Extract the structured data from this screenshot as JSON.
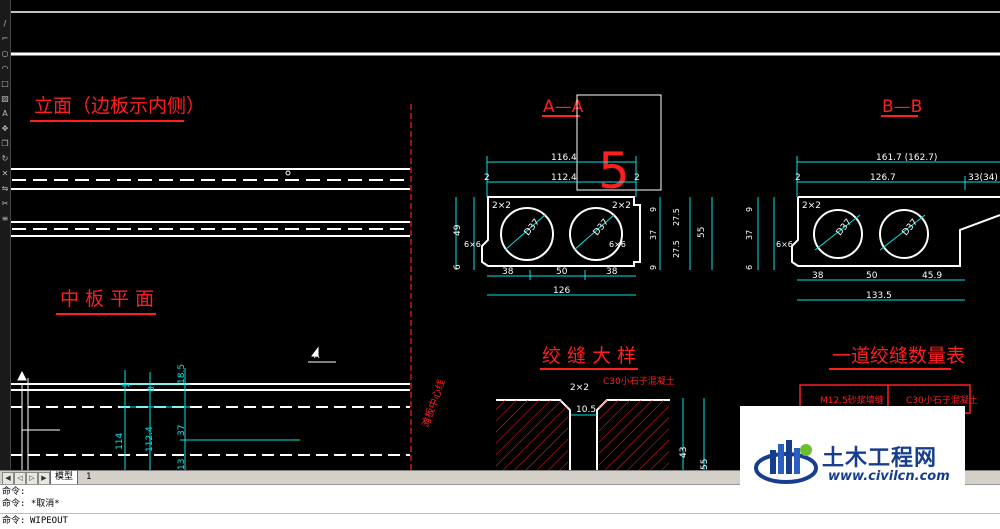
{
  "drawing": {
    "elevation_title": "立面（边板示内侧）",
    "middle_plan_title": "中 板 平 面",
    "section_a_title": "A—A",
    "section_b_title": "B—B",
    "joint_detail_title": "绞 缝 大 样",
    "joint_table_title": "一道绞缝数量表",
    "big_number": "5",
    "centerline_text": "滩板中心线",
    "table_headers": [
      "M12.5砂浆填缝",
      "C30小石子混凝土"
    ],
    "c30_label": "C30小石子混凝土",
    "dims_a": {
      "top_total": "116.4",
      "top_inner": "112.4",
      "left_small": "2",
      "right_small": "2",
      "corner_tl": "2×2",
      "corner_tr": "2×2",
      "circle_left": "D37",
      "circle_right": "D37",
      "height_left": "49",
      "height_left_low": "6",
      "chamfer_left": "6×6",
      "chamfer_right": "6×6",
      "r_top": "9",
      "r_mid": "27.5",
      "r_mid2": "27.5",
      "r_bot": "9",
      "r_37": "37",
      "r_55": "55",
      "bot_38": "38",
      "bot_50": "50",
      "bot_38b": "38",
      "bot_total": "126"
    },
    "dims_b": {
      "top_total": "161.7 (162.7)",
      "top_inner": "126.7",
      "top_right": "33(34)",
      "left_small": "2",
      "corner_tl": "2×2",
      "circle_left": "D37",
      "circle_right": "D37",
      "height_9": "9",
      "height_37": "37",
      "height_6": "6",
      "chamfer_left": "6×6",
      "bot_38": "38",
      "bot_50": "50",
      "bot_459": "45.9",
      "bot_total": "133.5"
    },
    "dims_plan": {
      "d1": "1",
      "d2": "8",
      "d3": "18.5",
      "d4": "37",
      "d5": "114",
      "d6": "112.4",
      "d7": "13"
    },
    "dims_joint": {
      "corner": "2×2",
      "gap": "10.5",
      "h43": "43",
      "h55": "55"
    },
    "section_marker": "A"
  },
  "tabs": {
    "model": "模型",
    "layout": "1"
  },
  "command": {
    "history": [
      "命令:",
      "命令: *取消*"
    ],
    "prompt": "命令:",
    "current_value": "WIPEOUT"
  },
  "watermark": {
    "brand": "土木工程网",
    "url": "www.civilcn.com"
  },
  "colors": {
    "red": "#ff1e1e",
    "cyan": "#00e5e5",
    "white": "#ffffff",
    "brand_blue": "#173e8e"
  }
}
